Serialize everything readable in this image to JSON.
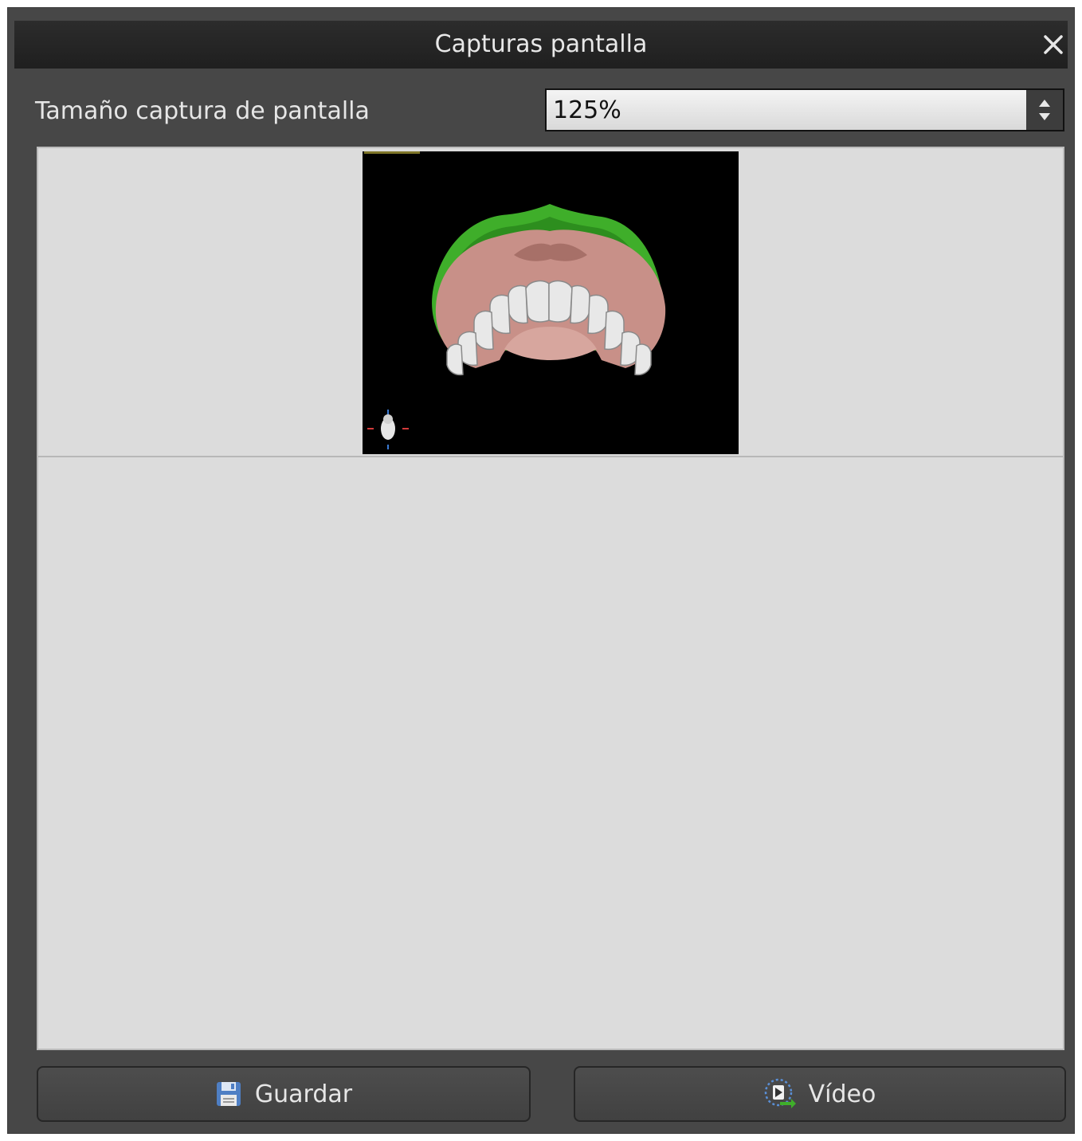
{
  "window": {
    "title": "Capturas pantalla"
  },
  "settings": {
    "size_label": "Tamaño captura de pantalla",
    "size_value": "125%"
  },
  "preview": {
    "thumbnails": [
      {
        "icon": "dental-3d-model-screenshot"
      }
    ]
  },
  "buttons": {
    "save_label": "Guardar",
    "save_icon": "floppy-disk-icon",
    "video_label": "Vídeo",
    "video_icon": "video-record-icon"
  },
  "colors": {
    "window_bg": "#474747",
    "titlebar_bg": "#1f1f1f",
    "panel_bg": "#dcdcdc",
    "gum": "#c89088",
    "model_base": "#3fae2a"
  }
}
